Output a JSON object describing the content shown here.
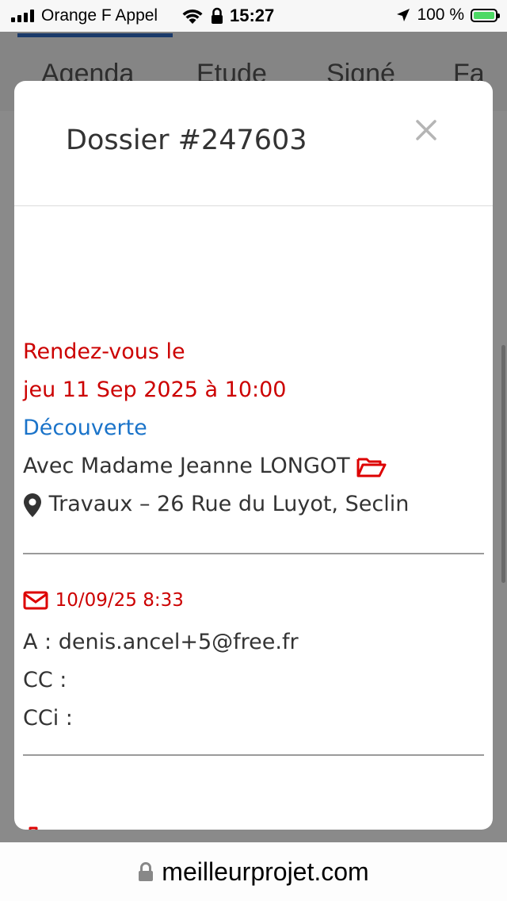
{
  "status_bar": {
    "carrier": "Orange F Appel",
    "time": "15:27",
    "battery": "100 %",
    "icons": [
      "signal-icon",
      "wifi-icon",
      "lock-icon",
      "location-arrow-icon",
      "battery-charging-icon"
    ],
    "battery_color": "#4cd964"
  },
  "background_tabs": [
    "Agenda",
    "Etude",
    "Signé",
    "Fa"
  ],
  "modal": {
    "title": "Dossier #247603",
    "close_icon": "close-icon",
    "appointment": {
      "heading": "Rendez-vous le",
      "datetime": "jeu 11 Sep 2025 à 10:00",
      "type": "Découverte",
      "contact": "Avec Madame Jeanne LONGOT",
      "address": "Travaux – 26 Rue du Luyot, Seclin"
    },
    "email": {
      "sent_at": "10/09/25 8:33",
      "to": "A : denis.ancel+5@free.fr",
      "cc": "CC :",
      "cci": "CCi :"
    }
  },
  "url_bar": {
    "domain": "meilleurprojet.com"
  },
  "colors": {
    "red": "#cc0000",
    "blue": "#1a73c9",
    "text": "#333333"
  }
}
